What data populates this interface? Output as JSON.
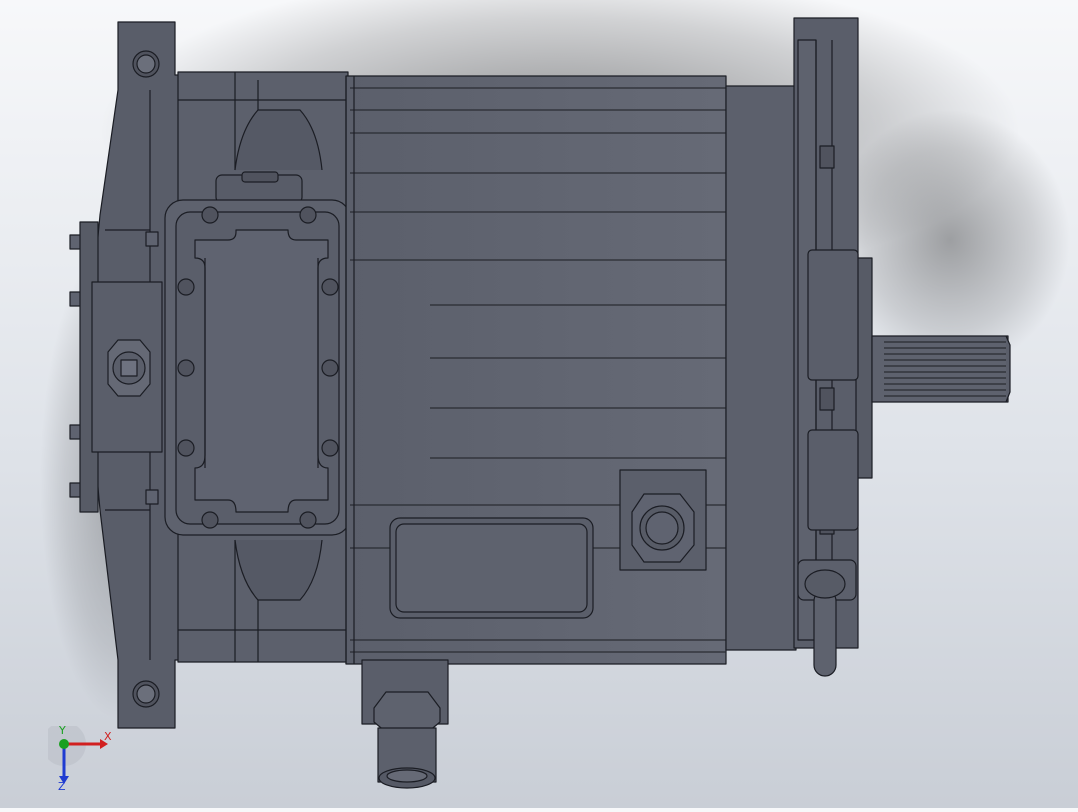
{
  "viewport": {
    "background_top": "#f7f8fa",
    "background_bottom": "#c9ced6",
    "model_color": "#5f6370",
    "edge_color": "#1b1d24"
  },
  "triad": {
    "x_label": "X",
    "y_label": "Y",
    "z_label": "Z",
    "x_color": "#d11f1f",
    "y_color": "#18a01f",
    "z_color": "#1f3bd1"
  }
}
